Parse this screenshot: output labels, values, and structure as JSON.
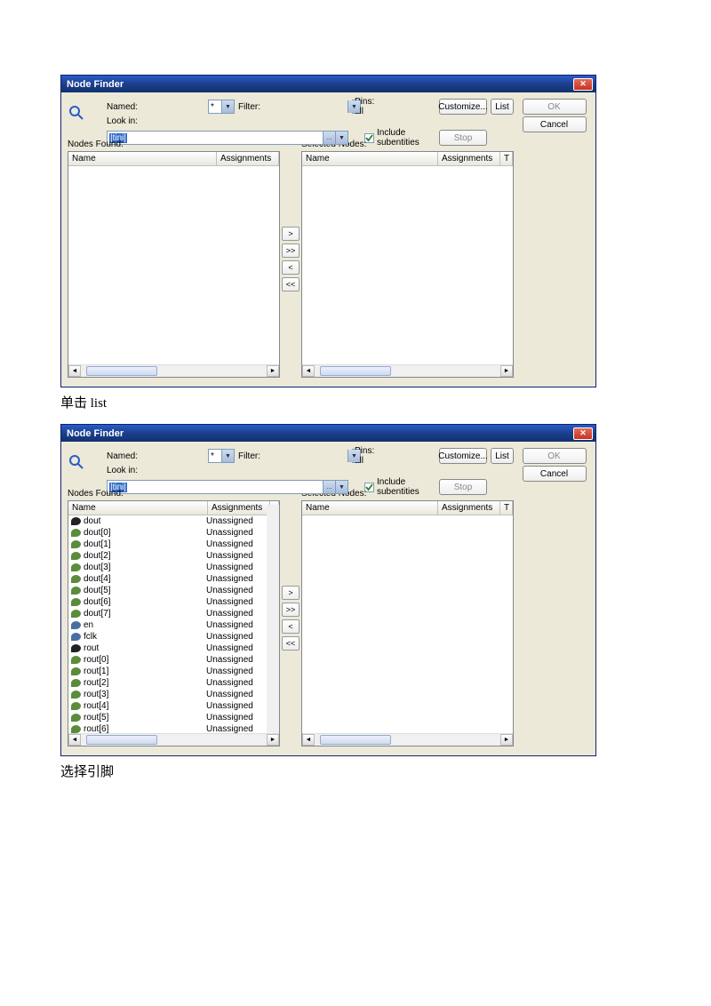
{
  "dialogs": [
    {
      "title": "Node Finder",
      "named_value": "*",
      "filter_value": "Pins: all",
      "lookin_value": "|tini|",
      "customize_label": "Customize...",
      "list_label": "List",
      "stop_label": "Stop",
      "include_label": "Include subentities",
      "include_checked": true,
      "ok_label": "OK",
      "cancel_label": "Cancel",
      "found_label": "Nodes Found:",
      "selected_label": "Selected Nodes:",
      "header_name": "Name",
      "header_assign": "Assignments",
      "header_t": "T",
      "named_label": "Named:",
      "filter_label": "Filter:",
      "lookin_label": "Look in:",
      "move_btns": [
        ">",
        ">>",
        "<",
        "<<"
      ],
      "rows_found": [],
      "rows_selected": []
    },
    {
      "title": "Node Finder",
      "named_value": "*",
      "filter_value": "Pins: all",
      "lookin_value": "|tini|",
      "customize_label": "Customize...",
      "list_label": "List",
      "stop_label": "Stop",
      "include_label": "Include subentities",
      "include_checked": true,
      "ok_label": "OK",
      "cancel_label": "Cancel",
      "found_label": "Nodes Found:",
      "selected_label": "Selected Nodes:",
      "header_name": "Name",
      "header_assign": "Assignments",
      "header_t": "T",
      "named_label": "Named:",
      "filter_label": "Filter:",
      "lookin_label": "Look in:",
      "move_btns": [
        ">",
        ">>",
        "<",
        "<<"
      ],
      "rows_found": [
        {
          "icon": "bus",
          "name": "dout",
          "assign": "Unassigned"
        },
        {
          "icon": "out",
          "name": "dout[0]",
          "assign": "Unassigned"
        },
        {
          "icon": "out",
          "name": "dout[1]",
          "assign": "Unassigned"
        },
        {
          "icon": "out",
          "name": "dout[2]",
          "assign": "Unassigned"
        },
        {
          "icon": "out",
          "name": "dout[3]",
          "assign": "Unassigned"
        },
        {
          "icon": "out",
          "name": "dout[4]",
          "assign": "Unassigned"
        },
        {
          "icon": "out",
          "name": "dout[5]",
          "assign": "Unassigned"
        },
        {
          "icon": "out",
          "name": "dout[6]",
          "assign": "Unassigned"
        },
        {
          "icon": "out",
          "name": "dout[7]",
          "assign": "Unassigned"
        },
        {
          "icon": "in",
          "name": "en",
          "assign": "Unassigned"
        },
        {
          "icon": "in",
          "name": "fclk",
          "assign": "Unassigned"
        },
        {
          "icon": "bus",
          "name": "rout",
          "assign": "Unassigned"
        },
        {
          "icon": "out",
          "name": "rout[0]",
          "assign": "Unassigned"
        },
        {
          "icon": "out",
          "name": "rout[1]",
          "assign": "Unassigned"
        },
        {
          "icon": "out",
          "name": "rout[2]",
          "assign": "Unassigned"
        },
        {
          "icon": "out",
          "name": "rout[3]",
          "assign": "Unassigned"
        },
        {
          "icon": "out",
          "name": "rout[4]",
          "assign": "Unassigned"
        },
        {
          "icon": "out",
          "name": "rout[5]",
          "assign": "Unassigned"
        },
        {
          "icon": "out",
          "name": "rout[6]",
          "assign": "Unassigned"
        }
      ],
      "rows_selected": []
    }
  ],
  "captions": [
    "单击 list",
    "选择引脚"
  ]
}
